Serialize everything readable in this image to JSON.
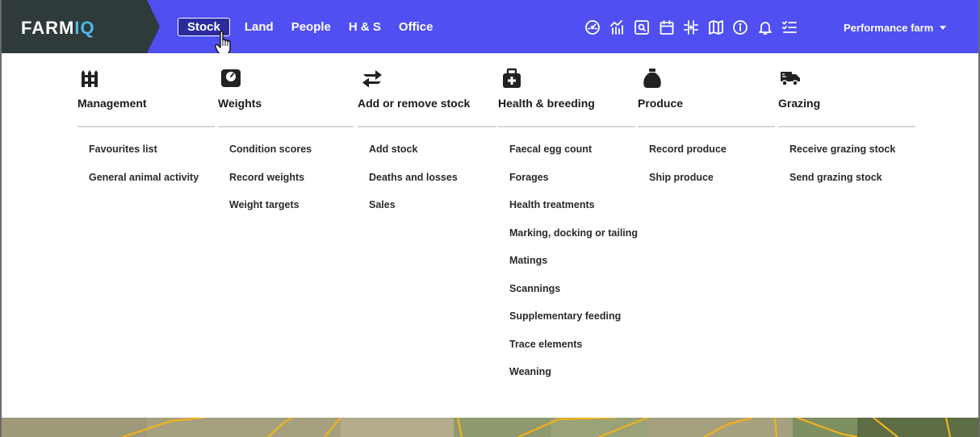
{
  "brand": {
    "logo_main": "FARM",
    "logo_accent": "IQ",
    "bar_color": "#4f4ff2",
    "logo_bg": "#2f3a3a",
    "accent_color": "#4fb8e8"
  },
  "nav": {
    "items": [
      {
        "label": "Stock",
        "active": true
      },
      {
        "label": "Land"
      },
      {
        "label": "People"
      },
      {
        "label": "H & S"
      },
      {
        "label": "Office"
      }
    ]
  },
  "toolbar_icons": [
    "dashboard-gauge-icon",
    "reports-chart-icon",
    "search-records-icon",
    "calendar-icon",
    "grid-plus-icon",
    "map-icon",
    "info-icon",
    "bell-icon",
    "task-list-icon"
  ],
  "farm_selector": {
    "label": "Performance farm"
  },
  "menu": {
    "columns": [
      {
        "icon": "fence-icon",
        "title": "Management",
        "links": [
          "Favourites list",
          "General animal activity"
        ]
      },
      {
        "icon": "scale-icon",
        "title": "Weights",
        "links": [
          "Condition scores",
          "Record weights",
          "Weight targets"
        ]
      },
      {
        "icon": "exchange-arrows-icon",
        "title": "Add or remove stock",
        "links": [
          "Add stock",
          "Deaths and losses",
          "Sales"
        ]
      },
      {
        "icon": "first-aid-kit-icon",
        "title": "Health & breeding",
        "links": [
          "Faecal egg count",
          "Forages",
          "Health treatments",
          "Marking, docking or tailing",
          "Matings",
          "Scannings",
          "Supplementary feeding",
          "Trace elements",
          "Weaning"
        ]
      },
      {
        "icon": "produce-sack-icon",
        "title": "Produce",
        "links": [
          "Record produce",
          "Ship produce"
        ]
      },
      {
        "icon": "truck-icon",
        "title": "Grazing",
        "links": [
          "Receive grazing stock",
          "Send grazing stock"
        ]
      }
    ]
  }
}
